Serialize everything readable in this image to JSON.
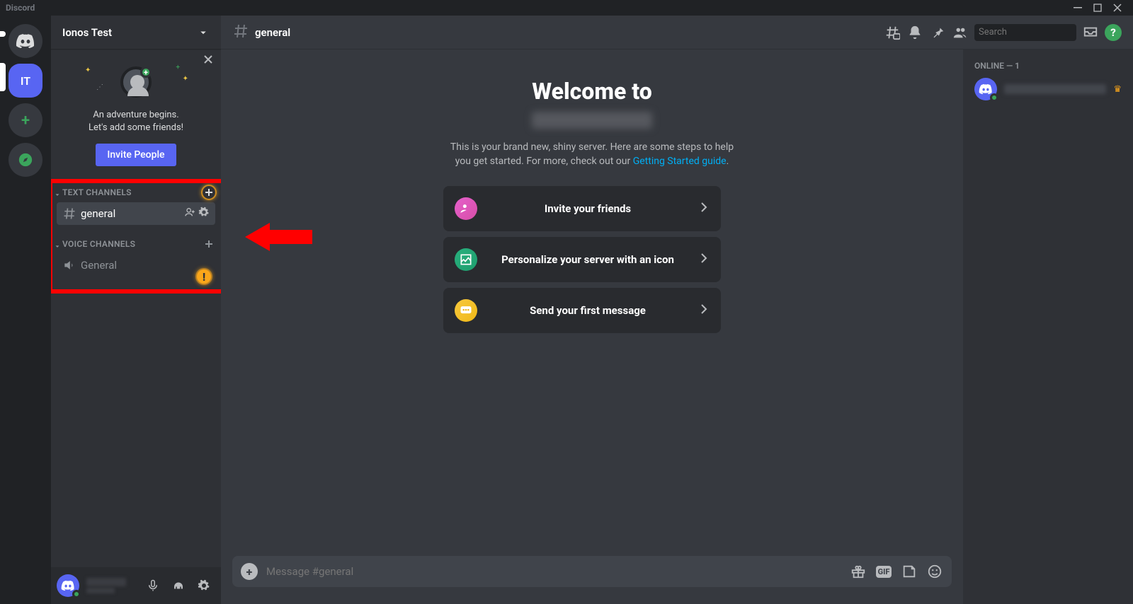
{
  "app": {
    "title": "Discord"
  },
  "servers": {
    "selected": {
      "label": "IT"
    }
  },
  "sidebar": {
    "server_name": "Ionos Test",
    "invite": {
      "line1": "An adventure begins.",
      "line2": "Let's add some friends!",
      "button": "Invite People"
    },
    "categories": [
      {
        "label": "TEXT CHANNELS",
        "channels": [
          {
            "name": "general",
            "active": true
          }
        ]
      },
      {
        "label": "VOICE CHANNELS",
        "channels": [
          {
            "name": "General",
            "active": false
          }
        ]
      }
    ]
  },
  "header": {
    "channel": "general",
    "search_placeholder": "Search"
  },
  "welcome": {
    "heading": "Welcome to",
    "desc_pre": "This is your brand new, shiny server. Here are some steps to help you get started. For more, check out our ",
    "link_text": "Getting Started guide",
    "desc_post": ".",
    "cards": [
      {
        "title": "Invite your friends"
      },
      {
        "title": "Personalize your server with an icon"
      },
      {
        "title": "Send your first message"
      }
    ]
  },
  "composer": {
    "placeholder": "Message #general"
  },
  "members": {
    "group": "ONLINE — 1"
  }
}
